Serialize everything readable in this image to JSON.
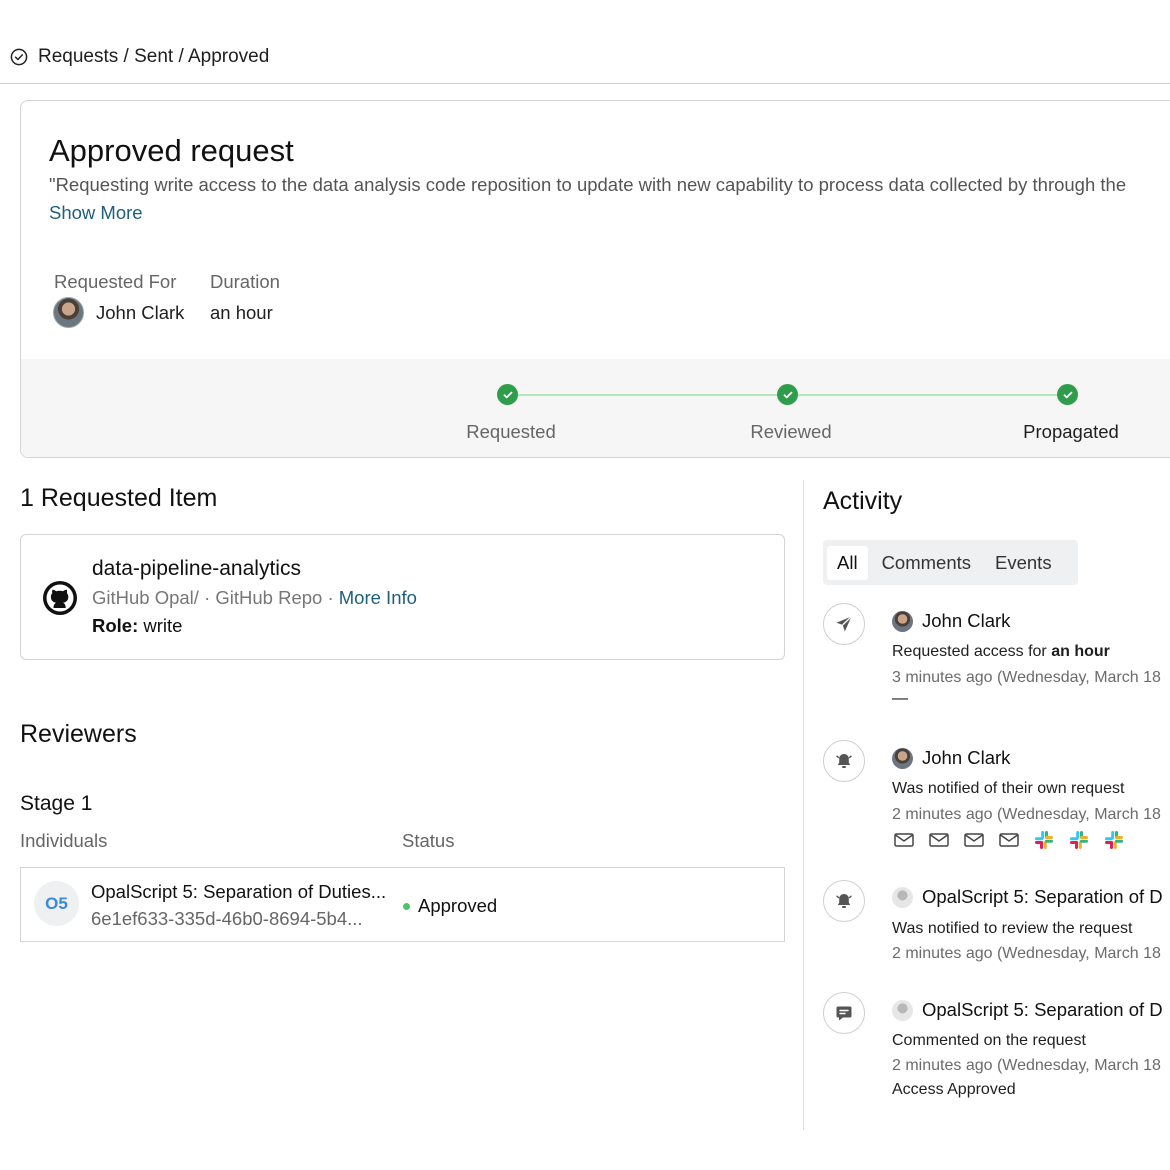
{
  "breadcrumb": {
    "text": "Requests / Sent / Approved"
  },
  "request": {
    "title": "Approved request",
    "description": "\"Requesting write access to the data analysis code reposition to update with new capability to process data collected by through the",
    "show_more": "Show More",
    "requested_for_label": "Requested For",
    "requested_for_value": "John Clark",
    "duration_label": "Duration",
    "duration_value": "an hour"
  },
  "progress": {
    "steps": [
      {
        "label": "Requested",
        "done": true
      },
      {
        "label": "Reviewed",
        "done": true
      },
      {
        "label": "Propagated",
        "done": true
      }
    ]
  },
  "items": {
    "heading": "1 Requested Item",
    "name": "data-pipeline-analytics",
    "source": "GitHub Opal/ · GitHub Repo · ",
    "more_info": "More Info",
    "role_label": "Role:",
    "role_value": " write"
  },
  "reviewers": {
    "heading": "Reviewers",
    "stage": "Stage 1",
    "col_individuals": "Individuals",
    "col_status": "Status",
    "row": {
      "initials": "O5",
      "name": "OpalScript 5: Separation of Duties...",
      "id": "6e1ef633-335d-46b0-8694-5b4...",
      "status": "Approved",
      "status_color": "#4cc36a"
    }
  },
  "activity": {
    "heading": "Activity",
    "tabs": [
      "All",
      "Comments",
      "Events"
    ],
    "active_tab": "All",
    "events": [
      {
        "icon": "send-icon",
        "actor": "John Clark",
        "text_prefix": "Requested access for ",
        "text_bold": "an hour",
        "time": "3 minutes ago (Wednesday, March 18",
        "extra": "—"
      },
      {
        "icon": "bell-icon",
        "actor": "John Clark",
        "text": "Was notified of their own request",
        "time": "2 minutes ago (Wednesday, March 18",
        "channels": [
          "mail-icon",
          "mail-icon",
          "mail-icon",
          "mail-icon",
          "slack-icon",
          "slack-icon",
          "slack-icon"
        ]
      },
      {
        "icon": "bell-icon",
        "actor": "OpalScript 5: Separation of D",
        "text": "Was notified to review the request",
        "time": "2 minutes ago (Wednesday, March 18"
      },
      {
        "icon": "comment-icon",
        "actor": "OpalScript 5: Separation of D",
        "text": "Commented on the request",
        "time": "2 minutes ago (Wednesday, March 18",
        "comment": "Access Approved"
      }
    ]
  },
  "colors": {
    "link": "#1e5f7d",
    "success": "#2e9e4b",
    "progress_line": "#b6e6bc"
  }
}
